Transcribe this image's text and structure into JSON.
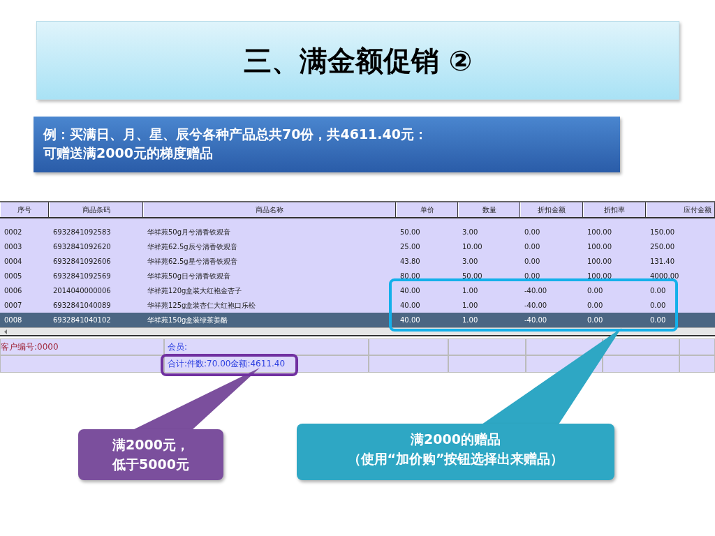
{
  "slide": {
    "title": "三、满金额促销 ②",
    "note_lines": [
      "例：买满日、月、星、辰兮各种产品总共70份，共4611.40元：",
      "可赠送满2000元的梯度赠品"
    ]
  },
  "table": {
    "columns": [
      "序号",
      "商品条码",
      "商品名称",
      "单价",
      "数量",
      "折扣金额",
      "折扣率",
      "应付金额"
    ],
    "rows": [
      {
        "cells": [
          "0002",
          "6932841092583",
          "华祥苑50g月兮清香铁观音",
          "50.00",
          "3.00",
          "0.00",
          "100.00",
          "150.00"
        ],
        "selected": false
      },
      {
        "cells": [
          "0003",
          "6932841092620",
          "华祥苑62.5g辰兮清香铁观音",
          "25.00",
          "10.00",
          "0.00",
          "100.00",
          "250.00"
        ],
        "selected": false
      },
      {
        "cells": [
          "0004",
          "6932841092606",
          "华祥苑62.5g星兮清香铁观音",
          "43.80",
          "3.00",
          "0.00",
          "100.00",
          "131.40"
        ],
        "selected": false
      },
      {
        "cells": [
          "0005",
          "6932841092569",
          "华祥苑50g日兮清香铁观音",
          "80.00",
          "50.00",
          "0.00",
          "100.00",
          "4000.00"
        ],
        "selected": false
      },
      {
        "cells": [
          "0006",
          "2014040000006",
          "华祥苑120g盒装大红袍金杏子",
          "40.00",
          "1.00",
          "-40.00",
          "0.00",
          "0.00"
        ],
        "selected": false
      },
      {
        "cells": [
          "0007",
          "6932841040089",
          "华祥苑125g盒装杏仁大红袍口乐松",
          "40.00",
          "1.00",
          "-40.00",
          "0.00",
          "0.00"
        ],
        "selected": false
      },
      {
        "cells": [
          "0008",
          "6932841040102",
          "华祥苑150g盒装绿茶姜酪",
          "40.00",
          "1.00",
          "-40.00",
          "0.00",
          "0.00"
        ],
        "selected": true
      }
    ]
  },
  "footer": {
    "customer": "客户编号:0000",
    "member": "会员:",
    "total": "合计:件数:70.00金额:4611.40"
  },
  "callouts": [
    {
      "lines": [
        "满2000元，",
        "低于5000元"
      ],
      "color": "#7b4f9d"
    },
    {
      "lines": [
        "满2000的赠品",
        "（使用“加价购”按钮选择出来赠品）"
      ],
      "color": "#2ea7c4"
    }
  ]
}
